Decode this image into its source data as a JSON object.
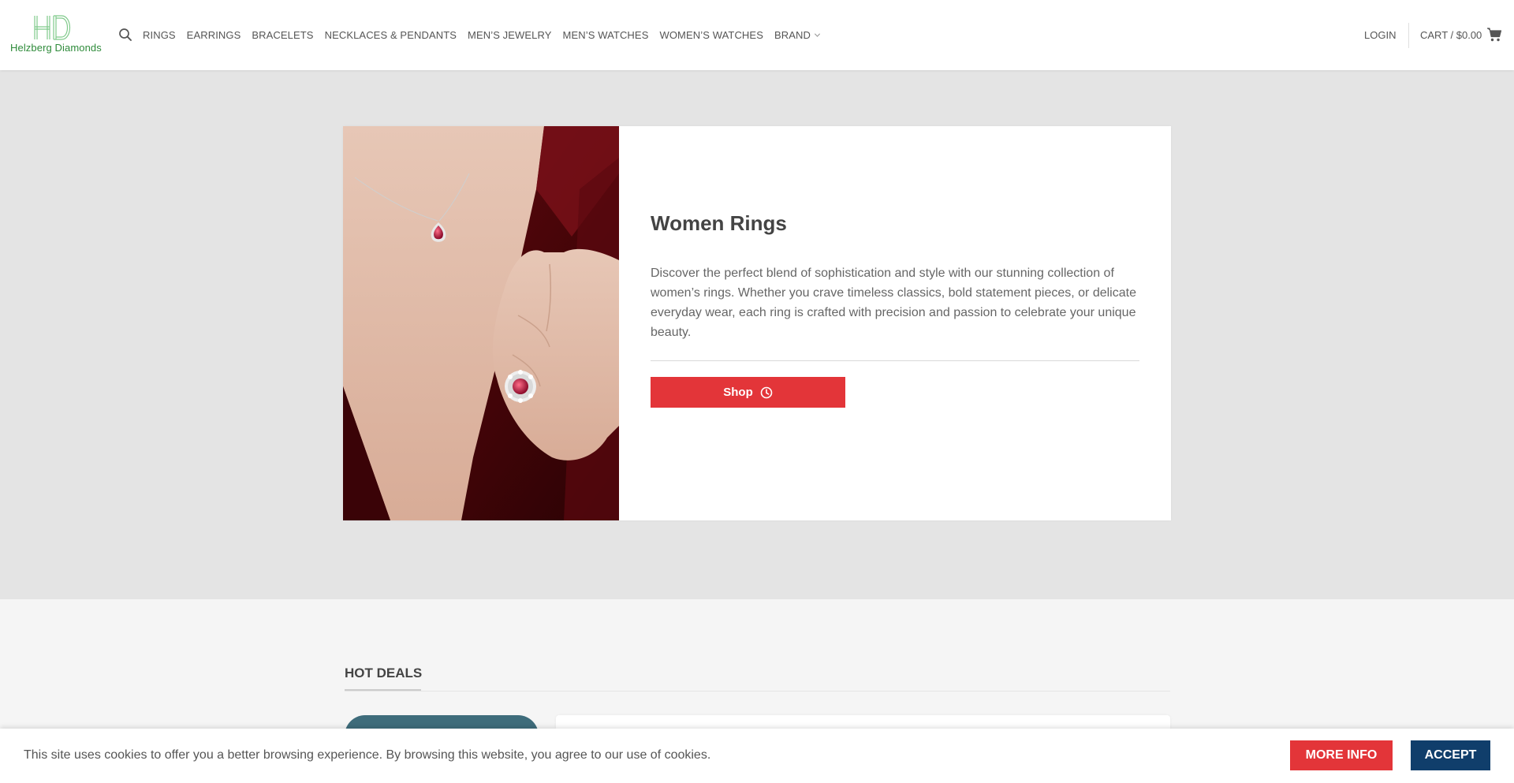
{
  "header": {
    "logo_text": "Helzberg Diamonds",
    "logo_monogram": "HD",
    "nav": [
      {
        "label": "RINGS"
      },
      {
        "label": "EARRINGS"
      },
      {
        "label": "BRACELETS"
      },
      {
        "label": "NECKLACES & PENDANTS"
      },
      {
        "label": "MEN’S JEWELRY"
      },
      {
        "label": "MEN’S WATCHES"
      },
      {
        "label": "WOMEN’S WATCHES"
      },
      {
        "label": "BRAND"
      }
    ],
    "login_label": "LOGIN",
    "cart_label": "CART / $0.00"
  },
  "hero": {
    "title": "Women Rings",
    "description": " Discover the perfect blend of sophistication and style with our stunning collection of women’s rings. Whether you crave timeless classics, bold statement pieces, or delicate everyday wear, each ring is crafted with precision and passion to celebrate your unique beauty.",
    "shop_label": "Shop"
  },
  "hot_deals": {
    "title": "HOT DEALS"
  },
  "cookie": {
    "text": "This site uses cookies to offer you a better browsing experience. By browsing this website, you agree to our use of cookies.",
    "more_info_label": "MORE INFO",
    "accept_label": "ACCEPT"
  },
  "colors": {
    "accent_red": "#e33539",
    "accept_blue": "#103e6b",
    "logo_green": "#2e8b3a",
    "hero_bg": "#e4e4e4",
    "deal_tab": "#3e6c7b"
  },
  "icons": [
    "search-icon",
    "chevron-down-icon",
    "cart-icon",
    "clock-icon"
  ]
}
